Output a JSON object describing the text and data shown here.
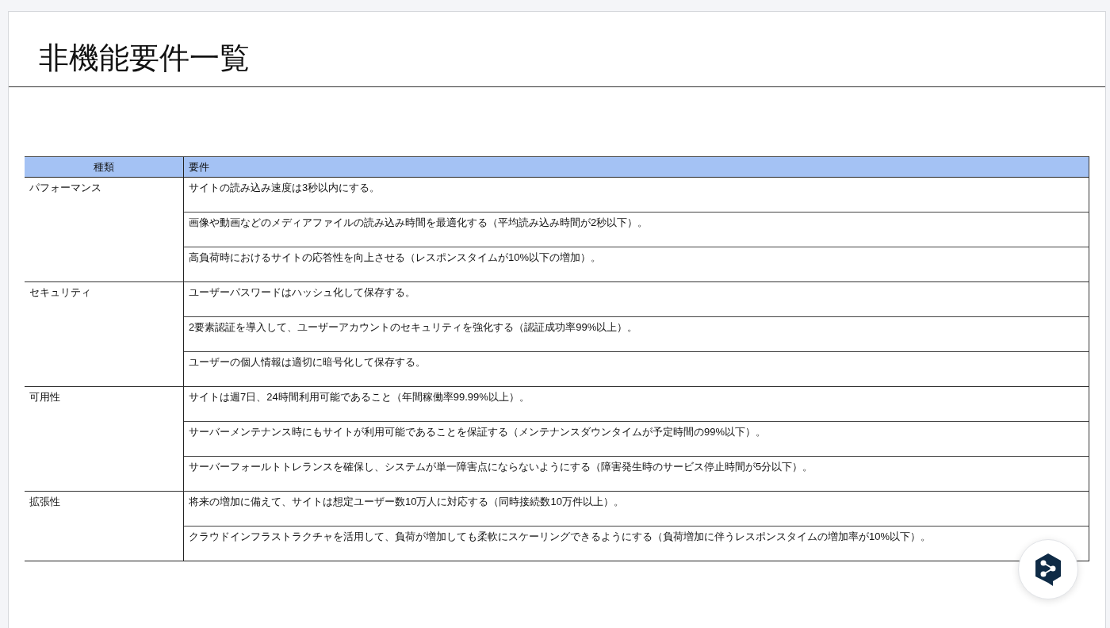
{
  "slide": {
    "title": "非機能要件一覧"
  },
  "table": {
    "columns": [
      "種類",
      "要件"
    ],
    "groups": [
      {
        "category": "パフォーマンス",
        "requirements": [
          "サイトの読み込み速度は3秒以内にする。",
          "画像や動画などのメディアファイルの読み込み時間を最適化する（平均読み込み時間が2秒以下）。",
          "高負荷時におけるサイトの応答性を向上させる（レスポンスタイムが10%以下の増加）。"
        ]
      },
      {
        "category": "セキュリティ",
        "requirements": [
          "ユーザーパスワードはハッシュ化して保存する。",
          "2要素認証を導入して、ユーザーアカウントのセキュリティを強化する（認証成功率99%以上）。",
          "ユーザーの個人情報は適切に暗号化して保存する。"
        ]
      },
      {
        "category": "可用性",
        "requirements": [
          "サイトは週7日、24時間利用可能であること（年間稼働率99.99%以上）。",
          "サーバーメンテナンス時にもサイトが利用可能であることを保証する（メンテナンスダウンタイムが予定時間の99%以下）。",
          "サーバーフォールトトレランスを確保し、システムが単一障害点にならないようにする（障害発生時のサービス停止時間が5分以下）。"
        ]
      },
      {
        "category": "拡張性",
        "requirements": [
          "将来の増加に備えて、サイトは想定ユーザー数10万人に対応する（同時接続数10万件以上）。",
          "クラウドインフラストラクチャを活用して、負荷が増加しても柔軟にスケーリングできるようにする（負荷増加に伴うレスポンスタイムの増加率が10%以下）。"
        ]
      }
    ]
  }
}
